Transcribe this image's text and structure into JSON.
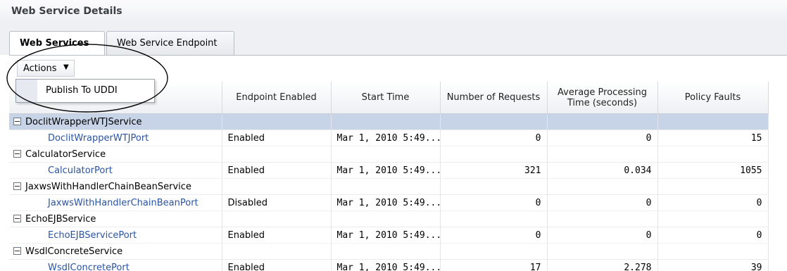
{
  "panel": {
    "title": "Web Service Details"
  },
  "tabs": [
    {
      "label": "Web Services",
      "active": true
    },
    {
      "label": "Web Service Endpoint",
      "active": false
    }
  ],
  "actions": {
    "label": "Actions",
    "menu_items": [
      "Publish To UDDI"
    ]
  },
  "table": {
    "columns": [
      "Endpoint Enabled",
      "Start Time",
      "Number of Requests",
      "Average Processing Time (seconds)",
      "Policy Faults"
    ],
    "groups": [
      {
        "service": "DoclitWrapperWTJService",
        "selected": true,
        "port": {
          "name": "DoclitWrapperWTJPort",
          "enabled": "Enabled",
          "start": "Mar 1, 2010 5:49...",
          "requests": "0",
          "avg": "0",
          "faults": "15"
        }
      },
      {
        "service": "CalculatorService",
        "selected": false,
        "port": {
          "name": "CalculatorPort",
          "enabled": "Enabled",
          "start": "Mar 1, 2010 5:49...",
          "requests": "321",
          "avg": "0.034",
          "faults": "1055"
        }
      },
      {
        "service": "JaxwsWithHandlerChainBeanService",
        "selected": false,
        "port": {
          "name": "JaxwsWithHandlerChainBeanPort",
          "enabled": "Disabled",
          "start": "Mar 1, 2010 5:49...",
          "requests": "0",
          "avg": "0",
          "faults": "0"
        }
      },
      {
        "service": "EchoEJBService",
        "selected": false,
        "port": {
          "name": "EchoEJBServicePort",
          "enabled": "Enabled",
          "start": "Mar 1, 2010 5:49...",
          "requests": "0",
          "avg": "0",
          "faults": "0"
        }
      },
      {
        "service": "WsdlConcreteService",
        "selected": false,
        "port": {
          "name": "WsdlConcretePort",
          "enabled": "Enabled",
          "start": "Mar 1, 2010 5:49...",
          "requests": "17",
          "avg": "2.278",
          "faults": "39"
        }
      }
    ]
  }
}
